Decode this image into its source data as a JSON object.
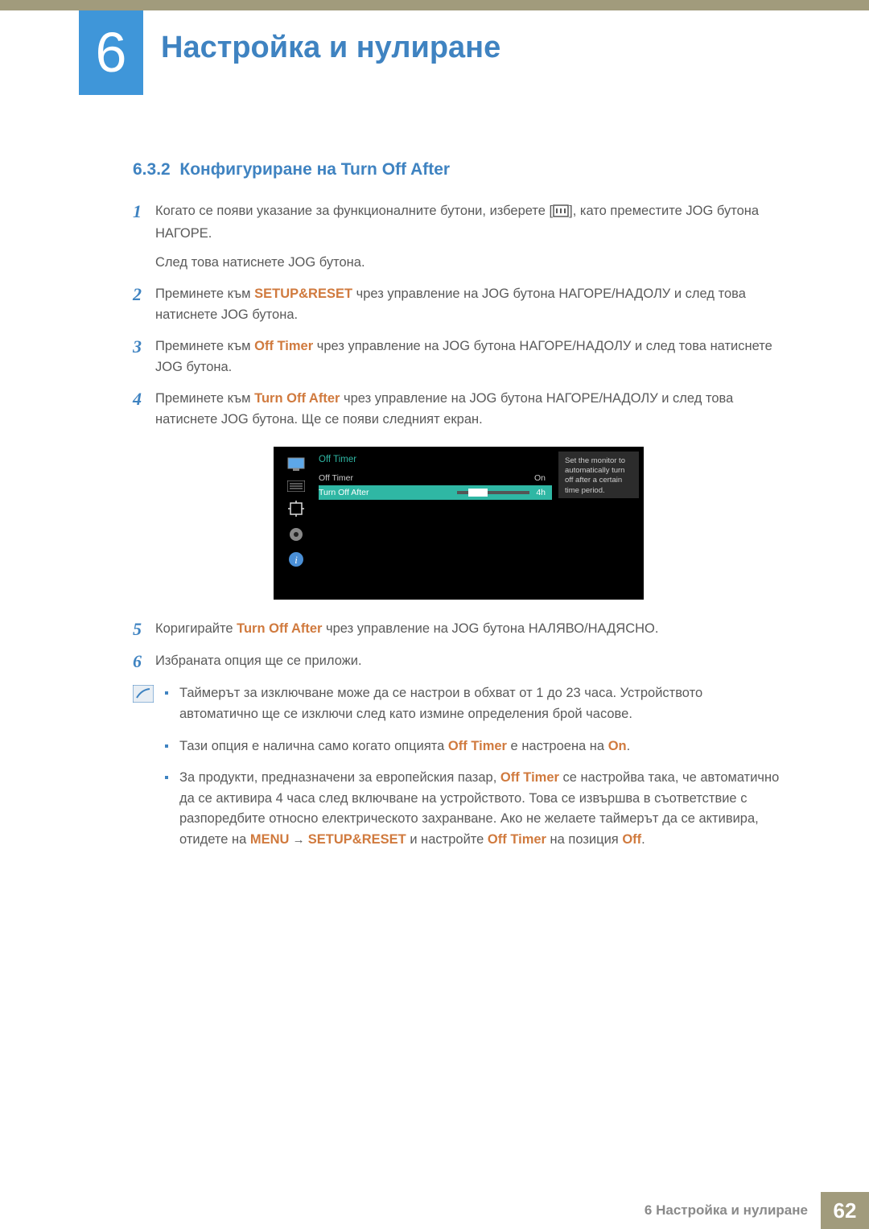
{
  "chapter": {
    "number": "6",
    "title": "Настройка и нулиране"
  },
  "section": {
    "number": "6.3.2",
    "heading": "Конфигуриране на Turn Off After"
  },
  "steps": {
    "s1": {
      "num": "1",
      "text_a": "Когато се появи указание за функционалните бутони, изберете [",
      "text_b": "], като преместите JOG бутона НАГОРЕ.",
      "line2": "След това натиснете JOG бутона."
    },
    "s2": {
      "num": "2",
      "text_a": "Преминете към ",
      "kw": "SETUP&RESET",
      "text_b": " чрез управление на JOG бутона НАГОРЕ/НАДОЛУ и след това натиснете JOG бутона."
    },
    "s3": {
      "num": "3",
      "text_a": "Преминете към ",
      "kw": "Off Timer",
      "text_b": " чрез управление на JOG бутона НАГОРЕ/НАДОЛУ и след това натиснете JOG бутона."
    },
    "s4": {
      "num": "4",
      "text_a": "Преминете към ",
      "kw": "Turn Off After",
      "text_b": " чрез управление на JOG бутона НАГОРЕ/НАДОЛУ и след това натиснете JOG бутона. Ще се появи следният екран."
    },
    "s5": {
      "num": "5",
      "text_a": "Коригирайте ",
      "kw": "Turn Off After",
      "text_b": " чрез управление на JOG бутона НАЛЯВО/НАДЯСНО."
    },
    "s6": {
      "num": "6",
      "text": "Избраната опция ще се приложи."
    }
  },
  "osd": {
    "title": "Off Timer",
    "row1_label": "Off Timer",
    "row1_value": "On",
    "row2_label": "Turn Off After",
    "row2_value": "4h",
    "help": "Set the monitor to automatically turn off after a certain time period."
  },
  "notes": {
    "n1": "Таймерът за изключване може да се настрои в обхват от 1 до 23 часа. Устройството автоматично ще се изключи след като измине определения брой часове.",
    "n2_a": "Тази опция е налична само когато опцията ",
    "n2_kw1": "Off Timer",
    "n2_b": " е настроена на ",
    "n2_kw2": "On",
    "n2_c": ".",
    "n3_a": "За продукти, предназначени за европейския пазар, ",
    "n3_kw1": "Off Timer",
    "n3_b": " се настройва така, че автоматично да се активира 4 часа след включване на устройството. Това се извършва в съответствие с разпоредбите относно електрическото захранване. Ако не желаете таймерът да се активира, отидете на ",
    "n3_kw2": "MENU",
    "n3_arrow": " → ",
    "n3_kw3": "SETUP&RESET",
    "n3_c": " и настройте ",
    "n3_kw4": "Off Timer",
    "n3_d": " на позиция ",
    "n3_kw5": "Off",
    "n3_e": "."
  },
  "footer": {
    "title": "6 Настройка и нулиране",
    "page": "62"
  }
}
